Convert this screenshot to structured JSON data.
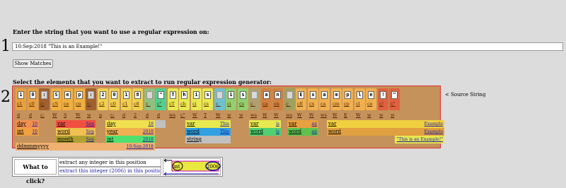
{
  "step1": {
    "number": "1",
    "heading": "Enter the string that you want to use a regular expression on:"
  },
  "input": {
    "value": "10:Sep:2018 \"This is an Example!\""
  },
  "show_button": {
    "label": "Show Matches"
  },
  "step2": {
    "number": "2",
    "heading": "Select the elements that you want to extract to run regular expression generator:"
  },
  "source_label": "< Source String",
  "chars": [
    {
      "ch": "1",
      "sub": "ç1",
      "bg": "#e8a040"
    },
    {
      "ch": "0",
      "sub": "ç0",
      "bg": "#e8a040"
    },
    {
      "ch": ":",
      "sub": "ç:",
      "bg": "#a06030",
      "gray": true
    },
    {
      "ch": "S",
      "sub": "çS",
      "bg": "#f0b040"
    },
    {
      "ch": "e",
      "sub": "çe",
      "bg": "#f0b040"
    },
    {
      "ch": "p",
      "sub": "çp",
      "bg": "#f0b040"
    },
    {
      "ch": ":",
      "sub": "ç:",
      "bg": "#a06030",
      "gray": true
    },
    {
      "ch": "2",
      "sub": "ç2",
      "bg": "#f0d050"
    },
    {
      "ch": "0",
      "sub": "ç0",
      "bg": "#f0d050"
    },
    {
      "ch": "1",
      "sub": "ç1",
      "bg": "#f0d050"
    },
    {
      "ch": "8",
      "sub": "ç8",
      "bg": "#f0d050"
    },
    {
      "ch": " ",
      "sub": "ç_",
      "bg": "#90c080",
      "gray": true
    },
    {
      "ch": "\"",
      "sub": "ç\"",
      "bg": "#50d090"
    },
    {
      "ch": "T",
      "sub": "çT",
      "bg": "#e8e850"
    },
    {
      "ch": "h",
      "sub": "çh",
      "bg": "#e8e850"
    },
    {
      "ch": "i",
      "sub": "çi",
      "bg": "#e8e850"
    },
    {
      "ch": "s",
      "sub": "çs",
      "bg": "#e8e850"
    },
    {
      "ch": " ",
      "sub": "ç_",
      "bg": "#70c0d0",
      "gray": true
    },
    {
      "ch": "i",
      "sub": "çi",
      "bg": "#90d070"
    },
    {
      "ch": "s",
      "sub": "çs",
      "bg": "#90d070"
    },
    {
      "ch": " ",
      "sub": "ç_",
      "bg": "#b0a070",
      "gray": true
    },
    {
      "ch": "a",
      "sub": "ça",
      "bg": "#d08040"
    },
    {
      "ch": "n",
      "sub": "çn",
      "bg": "#d08040"
    },
    {
      "ch": " ",
      "sub": "ç_",
      "bg": "#a0a060",
      "gray": true
    },
    {
      "ch": "E",
      "sub": "çE",
      "bg": "#f0b050"
    },
    {
      "ch": "x",
      "sub": "çx",
      "bg": "#f0b050"
    },
    {
      "ch": "a",
      "sub": "ça",
      "bg": "#f0b050"
    },
    {
      "ch": "m",
      "sub": "çm",
      "bg": "#f0b050"
    },
    {
      "ch": "p",
      "sub": "çp",
      "bg": "#f0b050"
    },
    {
      "ch": "l",
      "sub": "çl",
      "bg": "#f0b050"
    },
    {
      "ch": "e",
      "sub": "çe",
      "bg": "#f0b050"
    },
    {
      "ch": "!",
      "sub": "ç!",
      "bg": "#e06040"
    },
    {
      "ch": "\"",
      "sub": "ç\"",
      "bg": "#e06040"
    }
  ],
  "rows": {
    "r1": [
      "d",
      "d",
      "ç:",
      "W",
      "S",
      "W",
      "w",
      "p",
      "ç:",
      "d",
      "2",
      "d",
      "d",
      "ws",
      "ç\"",
      "W",
      "T",
      "W",
      "w",
      "w",
      "ws",
      "W",
      "W",
      "ws",
      "W",
      "W",
      "ws",
      "W",
      "E",
      "W",
      "w",
      "w",
      "w",
      "W",
      "ç!",
      "ç\""
    ],
    "r2": [
      {
        "l": "day",
        "r": "10",
        "bg": "#f09050"
      },
      {
        "l": "var",
        "r": "Sep",
        "bg": "#f05040"
      },
      {
        "l": "",
        "r": "",
        "bg": "#c0c0c0"
      },
      {
        "l": "day",
        "r": "18",
        "bg": "#f0e050"
      },
      {
        "l": "var",
        "r": "This",
        "bg": "#e8e850"
      },
      {
        "l": "var",
        "r": "is",
        "bg": "#e8e850"
      },
      {
        "l": "var",
        "r": "an",
        "bg": "#e8a040"
      },
      {
        "l": "var",
        "r": "Example",
        "bg": "#f0d040"
      }
    ],
    "r3": [
      {
        "l": "int",
        "r": "10",
        "bg": "#f0a040"
      },
      {
        "l": "word",
        "r": "Sep",
        "bg": "#f0c050"
      },
      {
        "l": "year",
        "r": "2018",
        "bg": "#f0b050"
      },
      {
        "l": "word",
        "r": "This",
        "bg": "#30a0e0"
      },
      {
        "l": "word",
        "r": "is",
        "bg": "#50d070"
      },
      {
        "l": "word",
        "r": "an",
        "bg": "#60c050"
      },
      {
        "l": "word",
        "r": "Example",
        "bg": "#e0a040"
      }
    ],
    "r4": [
      {
        "l": "month",
        "r": "Sep",
        "bg": "#b0a030"
      },
      {
        "l": "int",
        "r": "2018",
        "bg": "#50e070"
      },
      {
        "l": "string",
        "r": "",
        "bg": "#c0c0c0"
      },
      {
        "l": "",
        "r": "\"This is an Example!\"",
        "bg": "#e8e850"
      }
    ],
    "r5": [
      {
        "l": "ddmmmyyyy",
        "r": "10:Sep:2018",
        "bg": "#f0b070"
      }
    ]
  },
  "legend": {
    "what_label": "What to click?",
    "opt1": "extract any integer in this position",
    "opt2": "extract this integer (2006) in this position.",
    "demo_left": "int",
    "demo_right": "2006"
  }
}
